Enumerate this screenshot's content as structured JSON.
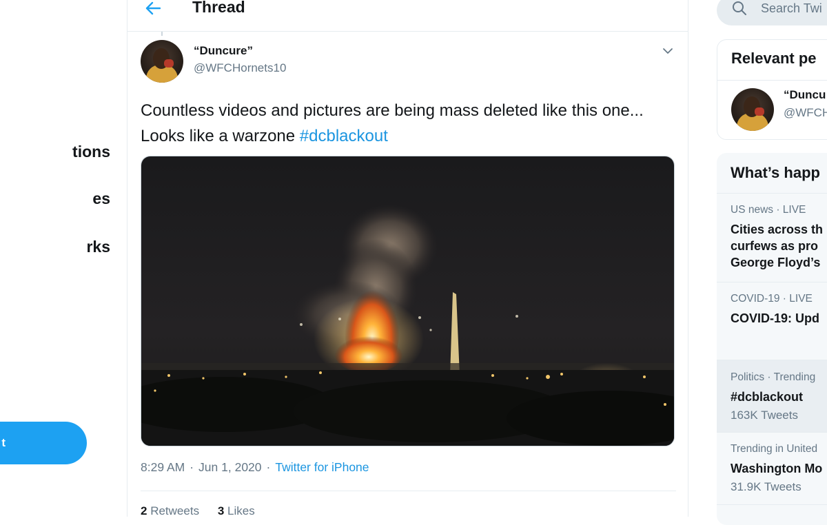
{
  "left_nav": {
    "items": [
      {
        "label": "tions"
      },
      {
        "label": "es"
      },
      {
        "label": "rks"
      }
    ],
    "tweet_button": "t"
  },
  "header": {
    "title": "Thread"
  },
  "tweet": {
    "author_name": "“Duncure”",
    "author_handle": "@WFCHornets10",
    "text_before": "Countless videos and pictures are being mass deleted like this one... Looks like a warzone ",
    "hashtag": "#dcblackout",
    "time": "8:29 AM",
    "date": "Jun 1, 2020",
    "separator": "·",
    "source": "Twitter for iPhone",
    "retweets_count": "2",
    "retweets_label": "Retweets",
    "likes_count": "3",
    "likes_label": "Likes"
  },
  "search": {
    "placeholder": "Search Twi"
  },
  "relevant_people": {
    "title": "Relevant pe",
    "person_name": "“Duncu",
    "person_handle": "@WFCH"
  },
  "whats_happening": {
    "title": "What’s happ",
    "trends": [
      {
        "category": "US news · LIVE",
        "title_lines": [
          "Cities across th",
          "curfews as pro",
          "George Floyd’s"
        ],
        "count": ""
      },
      {
        "category": "COVID-19 · LIVE",
        "title_lines": [
          "COVID-19: Upd"
        ],
        "count": ""
      },
      {
        "category": "Politics · Trending",
        "title_lines": [
          "#dcblackout"
        ],
        "count": "163K Tweets"
      },
      {
        "category": "Trending in United",
        "title_lines": [
          "Washington Mo"
        ],
        "count": "31.9K Tweets"
      }
    ]
  },
  "colors": {
    "accent": "#1da1f2",
    "link": "#1b95e0",
    "muted": "#657786",
    "border": "#e6ecf0"
  },
  "icons": [
    "back-arrow-icon",
    "chevron-down-icon",
    "search-icon"
  ]
}
